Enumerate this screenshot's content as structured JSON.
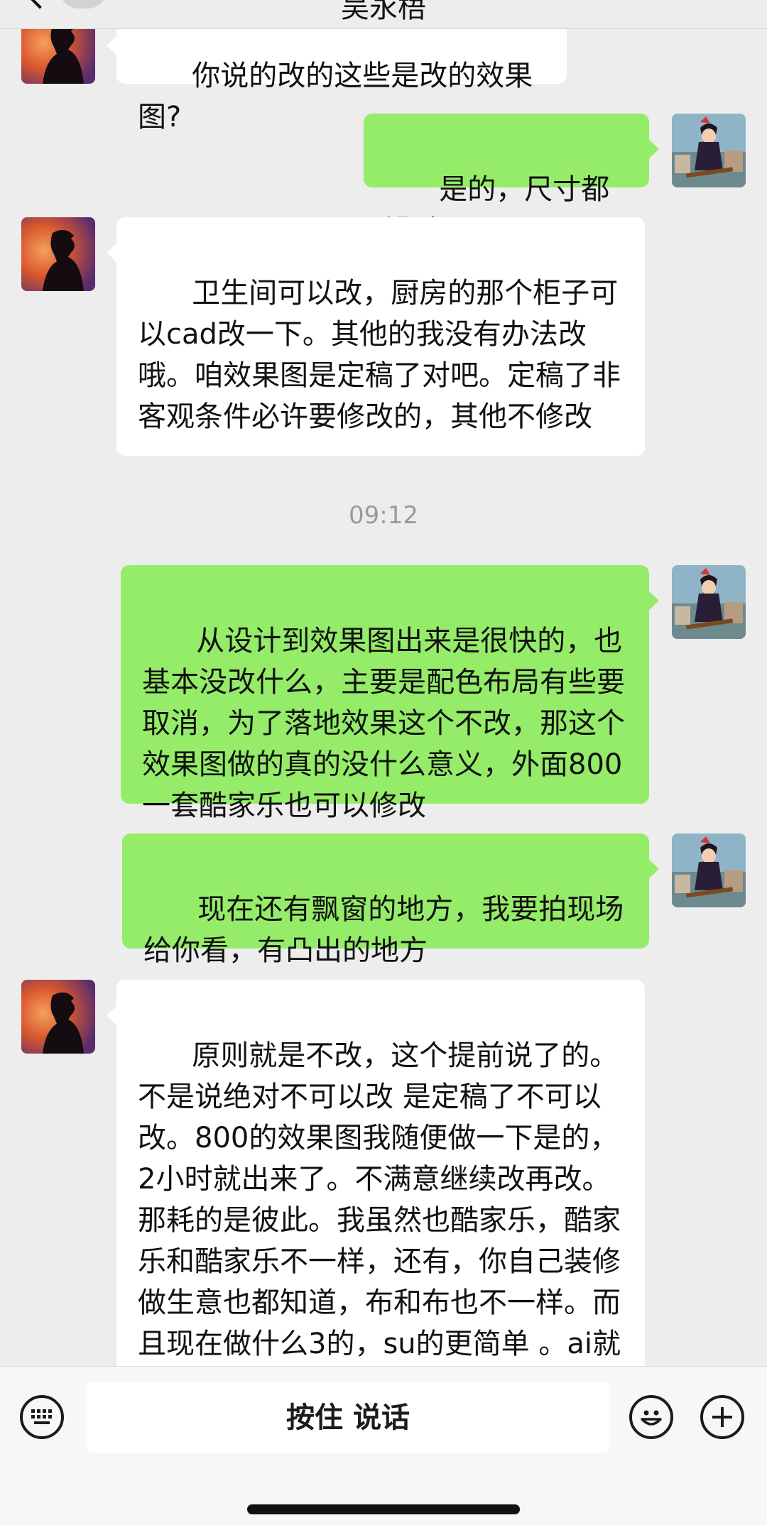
{
  "header": {
    "title": "吴永梧"
  },
  "messages": [
    {
      "side": "left",
      "text": "你说的改的这些是改的效果图?"
    },
    {
      "side": "right",
      "text": "是的，尺寸都没动"
    },
    {
      "side": "left",
      "text": "卫生间可以改，厨房的那个柜子可以cad改一下。其他的我没有办法改哦。咱效果图是定稿了对吧。定稿了非客观条件必许要修改的，其他不修改"
    },
    {
      "side": "right",
      "text": "从设计到效果图出来是很快的，也基本没改什么，主要是配色布局有些要取消，为了落地效果这个不改，那这个效果图做的真的没什么意义，外面800一套酷家乐也可以修改"
    },
    {
      "side": "right",
      "text": "现在还有飘窗的地方，我要拍现场给你看，有凸出的地方"
    },
    {
      "side": "left",
      "text": "原则就是不改，这个提前说了的。不是说绝对不可以改 是定稿了不可以改。800的效果图我随便做一下是的，2小时就出来了。不满意继续改再改。那耗的是彼此。我虽然也酷家乐，酷家乐和酷家乐不一样，还有，你自己装修做生意也都知道，布和布也不一样。而且现在做什么3的，su的更简单 。ai就行了。"
    }
  ],
  "timestamp": "09:12",
  "input_bar": {
    "voice_label": "按住 说话",
    "keyboard_icon": "keyboard-icon",
    "emoji_icon": "emoji-icon",
    "plus_icon": "plus-icon"
  },
  "colors": {
    "sent_bubble": "#95ec69",
    "received_bubble": "#ffffff",
    "background": "#ededed"
  }
}
